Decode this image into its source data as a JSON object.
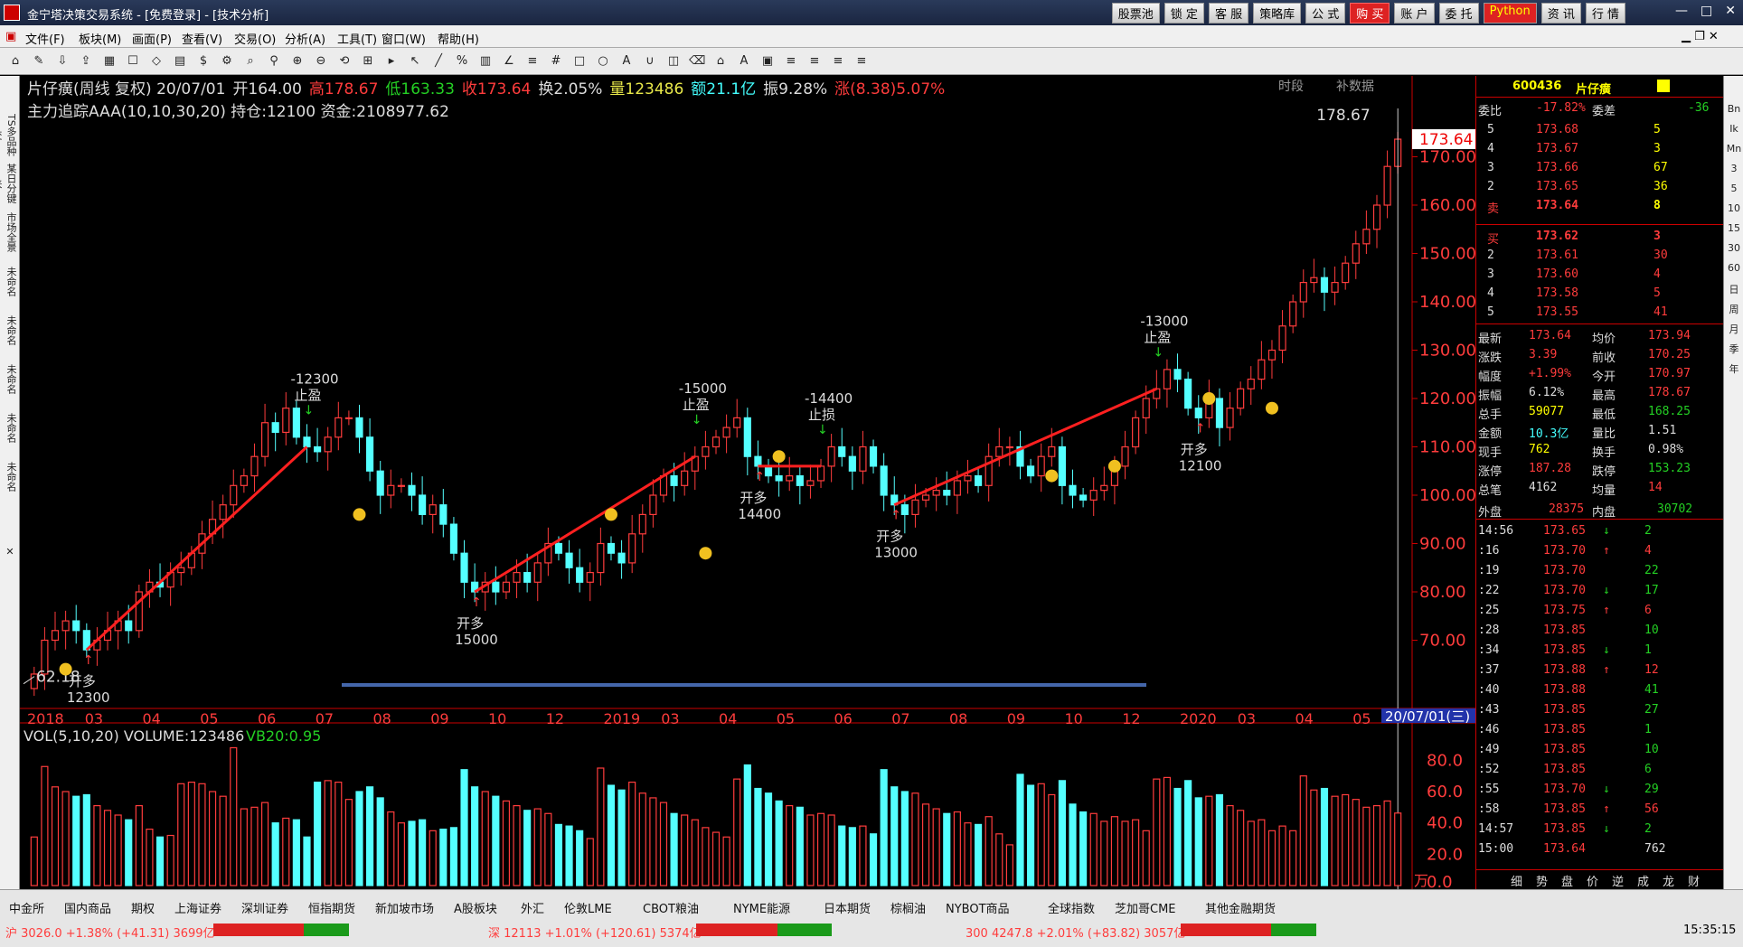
{
  "window": {
    "title": "金宁塔决策交易系统 - [免费登录] - [技术分析]"
  },
  "topnav": [
    "股票池",
    "锁 定",
    "客 服",
    "策略库",
    "公 式",
    "购 买",
    "账 户",
    "委 托",
    "Python",
    "资 讯",
    "行 情"
  ],
  "menu": [
    "文件(F)",
    "板块(M)",
    "画面(P)",
    "查看(V)",
    "交易(O)",
    "分析(A)",
    "工具(T)",
    "窗口(W)",
    "帮助(H)"
  ],
  "left_tabs": [
    "TS多品种交",
    "某日分键来",
    "市场全景",
    "未命名",
    "未命名",
    "未命名",
    "未命名",
    "未命名"
  ],
  "right_tabs": [
    "Bn",
    "Ik",
    "Mn",
    "3",
    "5",
    "10",
    "15",
    "30",
    "60",
    "日",
    "周",
    "月",
    "季",
    "年"
  ],
  "header": {
    "line1": [
      {
        "t": "片仔癀(周线 复权) 20/07/01",
        "c": "#ddd"
      },
      {
        "t": "开164.00",
        "c": "#ddd"
      },
      {
        "t": "高178.67",
        "c": "#ff3c3c"
      },
      {
        "t": "低163.33",
        "c": "#24d024"
      },
      {
        "t": "收173.64",
        "c": "#ff3c3c"
      },
      {
        "t": "换2.05%",
        "c": "#ddd"
      },
      {
        "t": "量123486",
        "c": "#e8e84a"
      },
      {
        "t": "额21.1亿",
        "c": "#4ff"
      },
      {
        "t": "振9.28%",
        "c": "#ddd"
      },
      {
        "t": "涨(8.38)5.07%",
        "c": "#ff3c3c"
      }
    ],
    "line2": "主力追踪AAA(10,10,30,20)  持仓:12100 资金:2108977.62",
    "tags": [
      "时段",
      "补数据"
    ]
  },
  "chart_data": {
    "type": "candlestick",
    "period": "weekly",
    "ylim": [
      60,
      180
    ],
    "yticks": [
      70,
      80,
      90,
      100,
      110,
      120,
      130,
      140,
      150,
      160,
      170
    ],
    "xticks": [
      "2018",
      "03",
      "04",
      "05",
      "06",
      "07",
      "08",
      "09",
      "10",
      "12",
      "2019",
      "03",
      "04",
      "05",
      "06",
      "07",
      "08",
      "09",
      "10",
      "12",
      "2020",
      "03",
      "04",
      "05"
    ],
    "high_label": "178.67",
    "low_label": "62.18",
    "last_price": "173.64",
    "cursor_date": "20/07/01(三)",
    "closes": [
      63,
      70,
      72,
      74,
      72,
      68,
      70,
      72,
      74,
      72,
      80,
      82,
      81,
      84,
      85,
      88,
      92,
      95,
      98,
      102,
      104,
      108,
      115,
      113,
      118,
      112,
      110,
      109,
      112,
      116,
      116,
      112,
      105,
      100,
      102,
      102,
      100,
      96,
      98,
      94,
      88,
      82,
      80,
      82,
      80,
      82,
      84,
      82,
      86,
      90,
      88,
      85,
      82,
      84,
      90,
      88,
      86,
      92,
      96,
      100,
      104,
      102,
      105,
      108,
      110,
      112,
      114,
      116,
      108,
      106,
      104,
      103,
      104,
      102,
      103,
      106,
      110,
      108,
      105,
      110,
      106,
      100,
      98,
      96,
      99,
      100,
      101,
      100,
      103,
      104,
      102,
      108,
      110,
      110,
      106,
      104,
      108,
      110,
      102,
      100,
      99,
      101,
      102,
      106,
      110,
      116,
      120,
      122,
      126,
      124,
      118,
      116,
      120,
      114,
      118,
      122,
      124,
      128,
      130,
      135,
      140,
      144,
      145,
      142,
      144,
      148,
      152,
      155,
      160,
      168,
      173.64
    ],
    "volume": {
      "label": "VOL(5,10,20) VOLUME:123486",
      "vb": "VB20:0.95",
      "ylim": [
        0,
        90
      ],
      "yticks": [
        0,
        20,
        40,
        60,
        80
      ],
      "unit": "万"
    },
    "signals": [
      {
        "type": "开多",
        "qty": "12300",
        "i": 5
      },
      {
        "type": "止盈",
        "qty": "-12300",
        "i": 26
      },
      {
        "type": "开多",
        "qty": "15000",
        "i": 42
      },
      {
        "type": "止盈",
        "qty": "-15000",
        "i": 63
      },
      {
        "type": "开多",
        "qty": "14400",
        "i": 69
      },
      {
        "type": "止损",
        "qty": "-14400",
        "i": 75
      },
      {
        "type": "开多",
        "qty": "13000",
        "i": 82
      },
      {
        "type": "止盈",
        "qty": "-13000",
        "i": 107
      },
      {
        "type": "开多",
        "qty": "12100",
        "i": 111
      }
    ]
  },
  "quote": {
    "code": "600436",
    "name": "片仔癀",
    "weibi_label": "委比",
    "weibi": "-17.82%",
    "weicha_label": "委差",
    "weicha": "-36",
    "asks": [
      [
        "5",
        "173.68",
        "5"
      ],
      [
        "4",
        "173.67",
        "3"
      ],
      [
        "3",
        "173.66",
        "67"
      ],
      [
        "2",
        "173.65",
        "36"
      ],
      [
        "卖",
        "173.64",
        "8"
      ]
    ],
    "bids": [
      [
        "买",
        "173.62",
        "3"
      ],
      [
        "2",
        "173.61",
        "30"
      ],
      [
        "3",
        "173.60",
        "4"
      ],
      [
        "4",
        "173.58",
        "5"
      ],
      [
        "5",
        "173.55",
        "41"
      ]
    ],
    "stats": [
      [
        "最新",
        "173.64",
        "均价",
        "173.94"
      ],
      [
        "涨跌",
        "3.39",
        "前收",
        "170.25"
      ],
      [
        "幅度",
        "+1.99%",
        "今开",
        "170.97"
      ],
      [
        "振幅",
        "6.12%",
        "最高",
        "178.67"
      ],
      [
        "总手",
        "59077",
        "最低",
        "168.25"
      ],
      [
        "金额",
        "10.3亿",
        "量比",
        "1.51"
      ],
      [
        "现手",
        "762",
        "换手",
        "0.98%"
      ],
      [
        "涨停",
        "187.28",
        "跌停",
        "153.23"
      ],
      [
        "总笔",
        "4162",
        "均量",
        "14"
      ]
    ],
    "waipan_label": "外盘",
    "waipan": "28375",
    "neipan_label": "内盘",
    "neipan": "30702",
    "ticks": [
      [
        "14:56",
        "173.65",
        "↓",
        "2"
      ],
      [
        ":16",
        "173.70",
        "↑",
        "4"
      ],
      [
        ":19",
        "173.70",
        "",
        "22"
      ],
      [
        ":22",
        "173.70",
        "↓",
        "17"
      ],
      [
        ":25",
        "173.75",
        "↑",
        "6"
      ],
      [
        ":28",
        "173.85",
        "",
        "10"
      ],
      [
        ":34",
        "173.85",
        "↓",
        "1"
      ],
      [
        ":37",
        "173.88",
        "↑",
        "12"
      ],
      [
        ":40",
        "173.88",
        "",
        "41"
      ],
      [
        ":43",
        "173.85",
        "",
        "27"
      ],
      [
        ":46",
        "173.85",
        "",
        "1"
      ],
      [
        ":49",
        "173.85",
        "",
        "10"
      ],
      [
        ":52",
        "173.85",
        "",
        "6"
      ],
      [
        ":55",
        "173.70",
        "↓",
        "29"
      ],
      [
        ":58",
        "173.85",
        "↑",
        "56"
      ],
      [
        "14:57",
        "173.85",
        "↓",
        "2"
      ],
      [
        "15:00",
        "173.64",
        "",
        "762"
      ]
    ],
    "bottom_tabs": [
      "细",
      "势",
      "盘",
      "价",
      "逆",
      "成",
      "龙",
      "财"
    ]
  },
  "bottom_tabs": [
    "中金所",
    "国内商品",
    "期权",
    "上海证券",
    "深圳证券",
    "恒指期货",
    "新加坡市场",
    "A股板块",
    "外汇",
    "伦敦LME",
    "CBOT粮油",
    "NYME能源",
    "日本期货",
    "棕榈油",
    "NYBOT商品",
    "全球指数",
    "芝加哥CME",
    "其他金融期货"
  ],
  "status": {
    "sh": "沪 3026.0 +1.38% (+41.31) 3699亿",
    "sz": "深 12113 +1.01% (+120.61) 5374亿",
    "cy": "300 4247.8 +2.01% (+83.82) 3057亿",
    "time": "15:35:15"
  }
}
